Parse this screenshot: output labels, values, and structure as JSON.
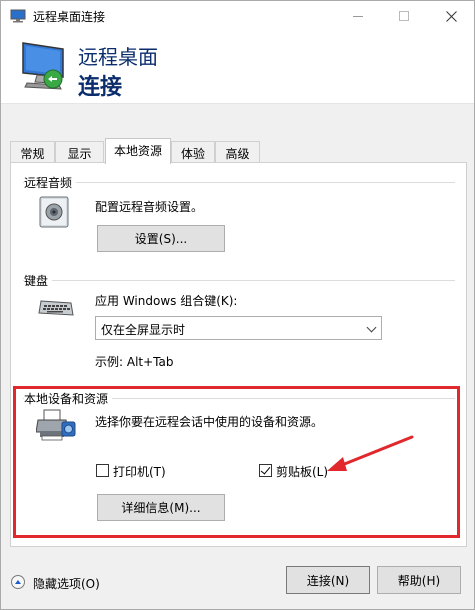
{
  "window": {
    "title": "远程桌面连接",
    "header_line1": "远程桌面",
    "header_line2": "连接"
  },
  "tabs": [
    {
      "label": "常规"
    },
    {
      "label": "显示"
    },
    {
      "label": "本地资源"
    },
    {
      "label": "体验"
    },
    {
      "label": "高级"
    }
  ],
  "audio": {
    "title": "远程音频",
    "description": "配置远程音频设置。",
    "settings_button": "设置(S)..."
  },
  "keyboard": {
    "title": "键盘",
    "description": "应用 Windows 组合键(K):",
    "select_value": "仅在全屏显示时",
    "example": "示例: Alt+Tab"
  },
  "local_devices": {
    "title": "本地设备和资源",
    "description": "选择你要在远程会话中使用的设备和资源。",
    "printer_label": "打印机(T)",
    "printer_checked": false,
    "clipboard_label": "剪贴板(L)",
    "clipboard_checked": true,
    "details_button": "详细信息(M)..."
  },
  "footer": {
    "hide_options": "隐藏选项(O)",
    "connect_button": "连接(N)",
    "help_button": "帮助(H)"
  },
  "colors": {
    "highlight": "#e0282d",
    "header_text": "#0b2d6e"
  }
}
